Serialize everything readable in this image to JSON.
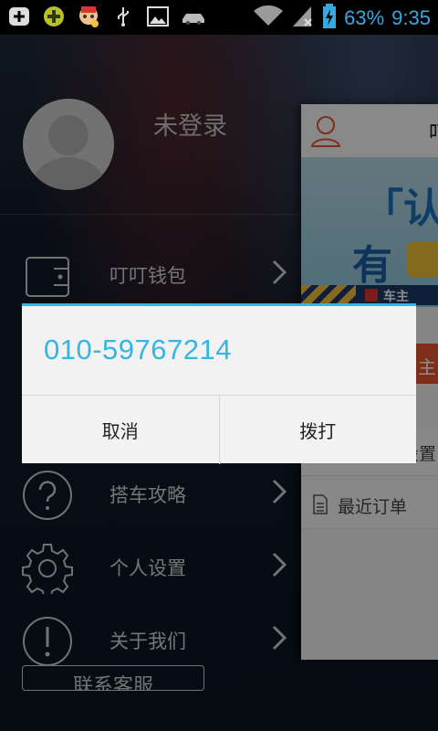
{
  "status_bar": {
    "battery": "63%",
    "time": "9:35",
    "icons": [
      "add-box-icon",
      "game-app-icon",
      "avatar-app-icon",
      "usb-icon",
      "image-icon",
      "car-app-icon",
      "wifi-icon",
      "no-signal-icon",
      "battery-charging-icon"
    ]
  },
  "drawer": {
    "username": "未登录",
    "items": [
      {
        "label": "叮叮钱包",
        "icon": "wallet-icon"
      },
      {
        "label": "搭车攻略",
        "icon": "help-icon"
      },
      {
        "label": "个人设置",
        "icon": "gear-icon"
      },
      {
        "label": "关于我们",
        "icon": "info-icon"
      }
    ],
    "contact_label": "联系客服"
  },
  "main": {
    "title": "叮",
    "banner_text1": "「认证",
    "banner_text2": "有",
    "banner_strip": "车主",
    "orange_button": "主",
    "rows": [
      {
        "label": "设置"
      },
      {
        "label": "最近订单",
        "icon": "document-icon"
      }
    ]
  },
  "dialog": {
    "phone": "010-59767214",
    "cancel_label": "取消",
    "call_label": "拨打"
  },
  "colors": {
    "accent": "#33b5e5",
    "orange": "#e8552a",
    "drawer_bg": "#0f1a28"
  }
}
